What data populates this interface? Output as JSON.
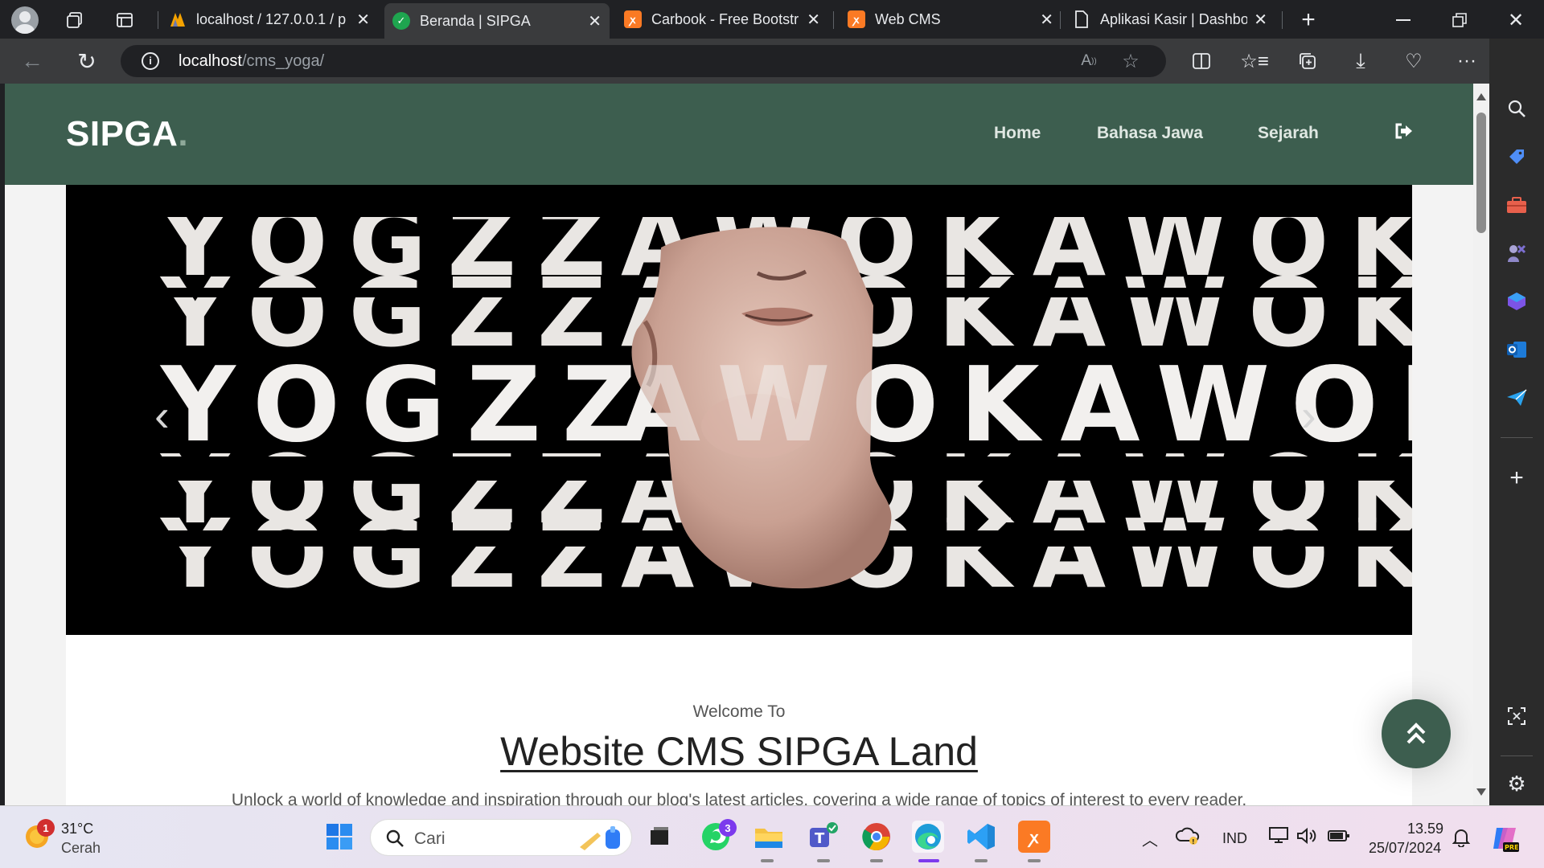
{
  "browser": {
    "tabs": [
      {
        "title": "localhost / 127.0.0.1 / p",
        "active": false
      },
      {
        "title": "Beranda | SIPGA",
        "active": true
      },
      {
        "title": "Carbook - Free Bootstr",
        "active": false
      },
      {
        "title": "Web CMS",
        "active": false
      },
      {
        "title": "Aplikasi Kasir | Dashbo",
        "active": false
      }
    ],
    "url_host": "localhost",
    "url_path": "/cms_yoga/"
  },
  "site": {
    "logo": "SIPGA",
    "logo_dot": ".",
    "nav": [
      "Home",
      "Bahasa Jawa",
      "Sejarah"
    ],
    "hero": {
      "rows": [
        "YOGZZ",
        "AWOKAWOK"
      ],
      "prev": "‹",
      "next": "›"
    },
    "welcome": "Welcome To",
    "title": "Website CMS SIPGA Land",
    "tagline": "Unlock a world of knowledge and inspiration through our blog's latest articles, covering a wide range of topics of interest to every reader.",
    "back_to_top": "⌃⌃"
  },
  "taskbar": {
    "weather_temp": "31°C",
    "weather_cond": "Cerah",
    "weather_badge": "1",
    "search_placeholder": "Cari",
    "whatsapp_badge": "3",
    "lang": "IND",
    "time": "13.59",
    "date": "25/07/2024"
  },
  "colors": {
    "header_green": "#3d5e4f",
    "chrome_dark": "#202124"
  }
}
